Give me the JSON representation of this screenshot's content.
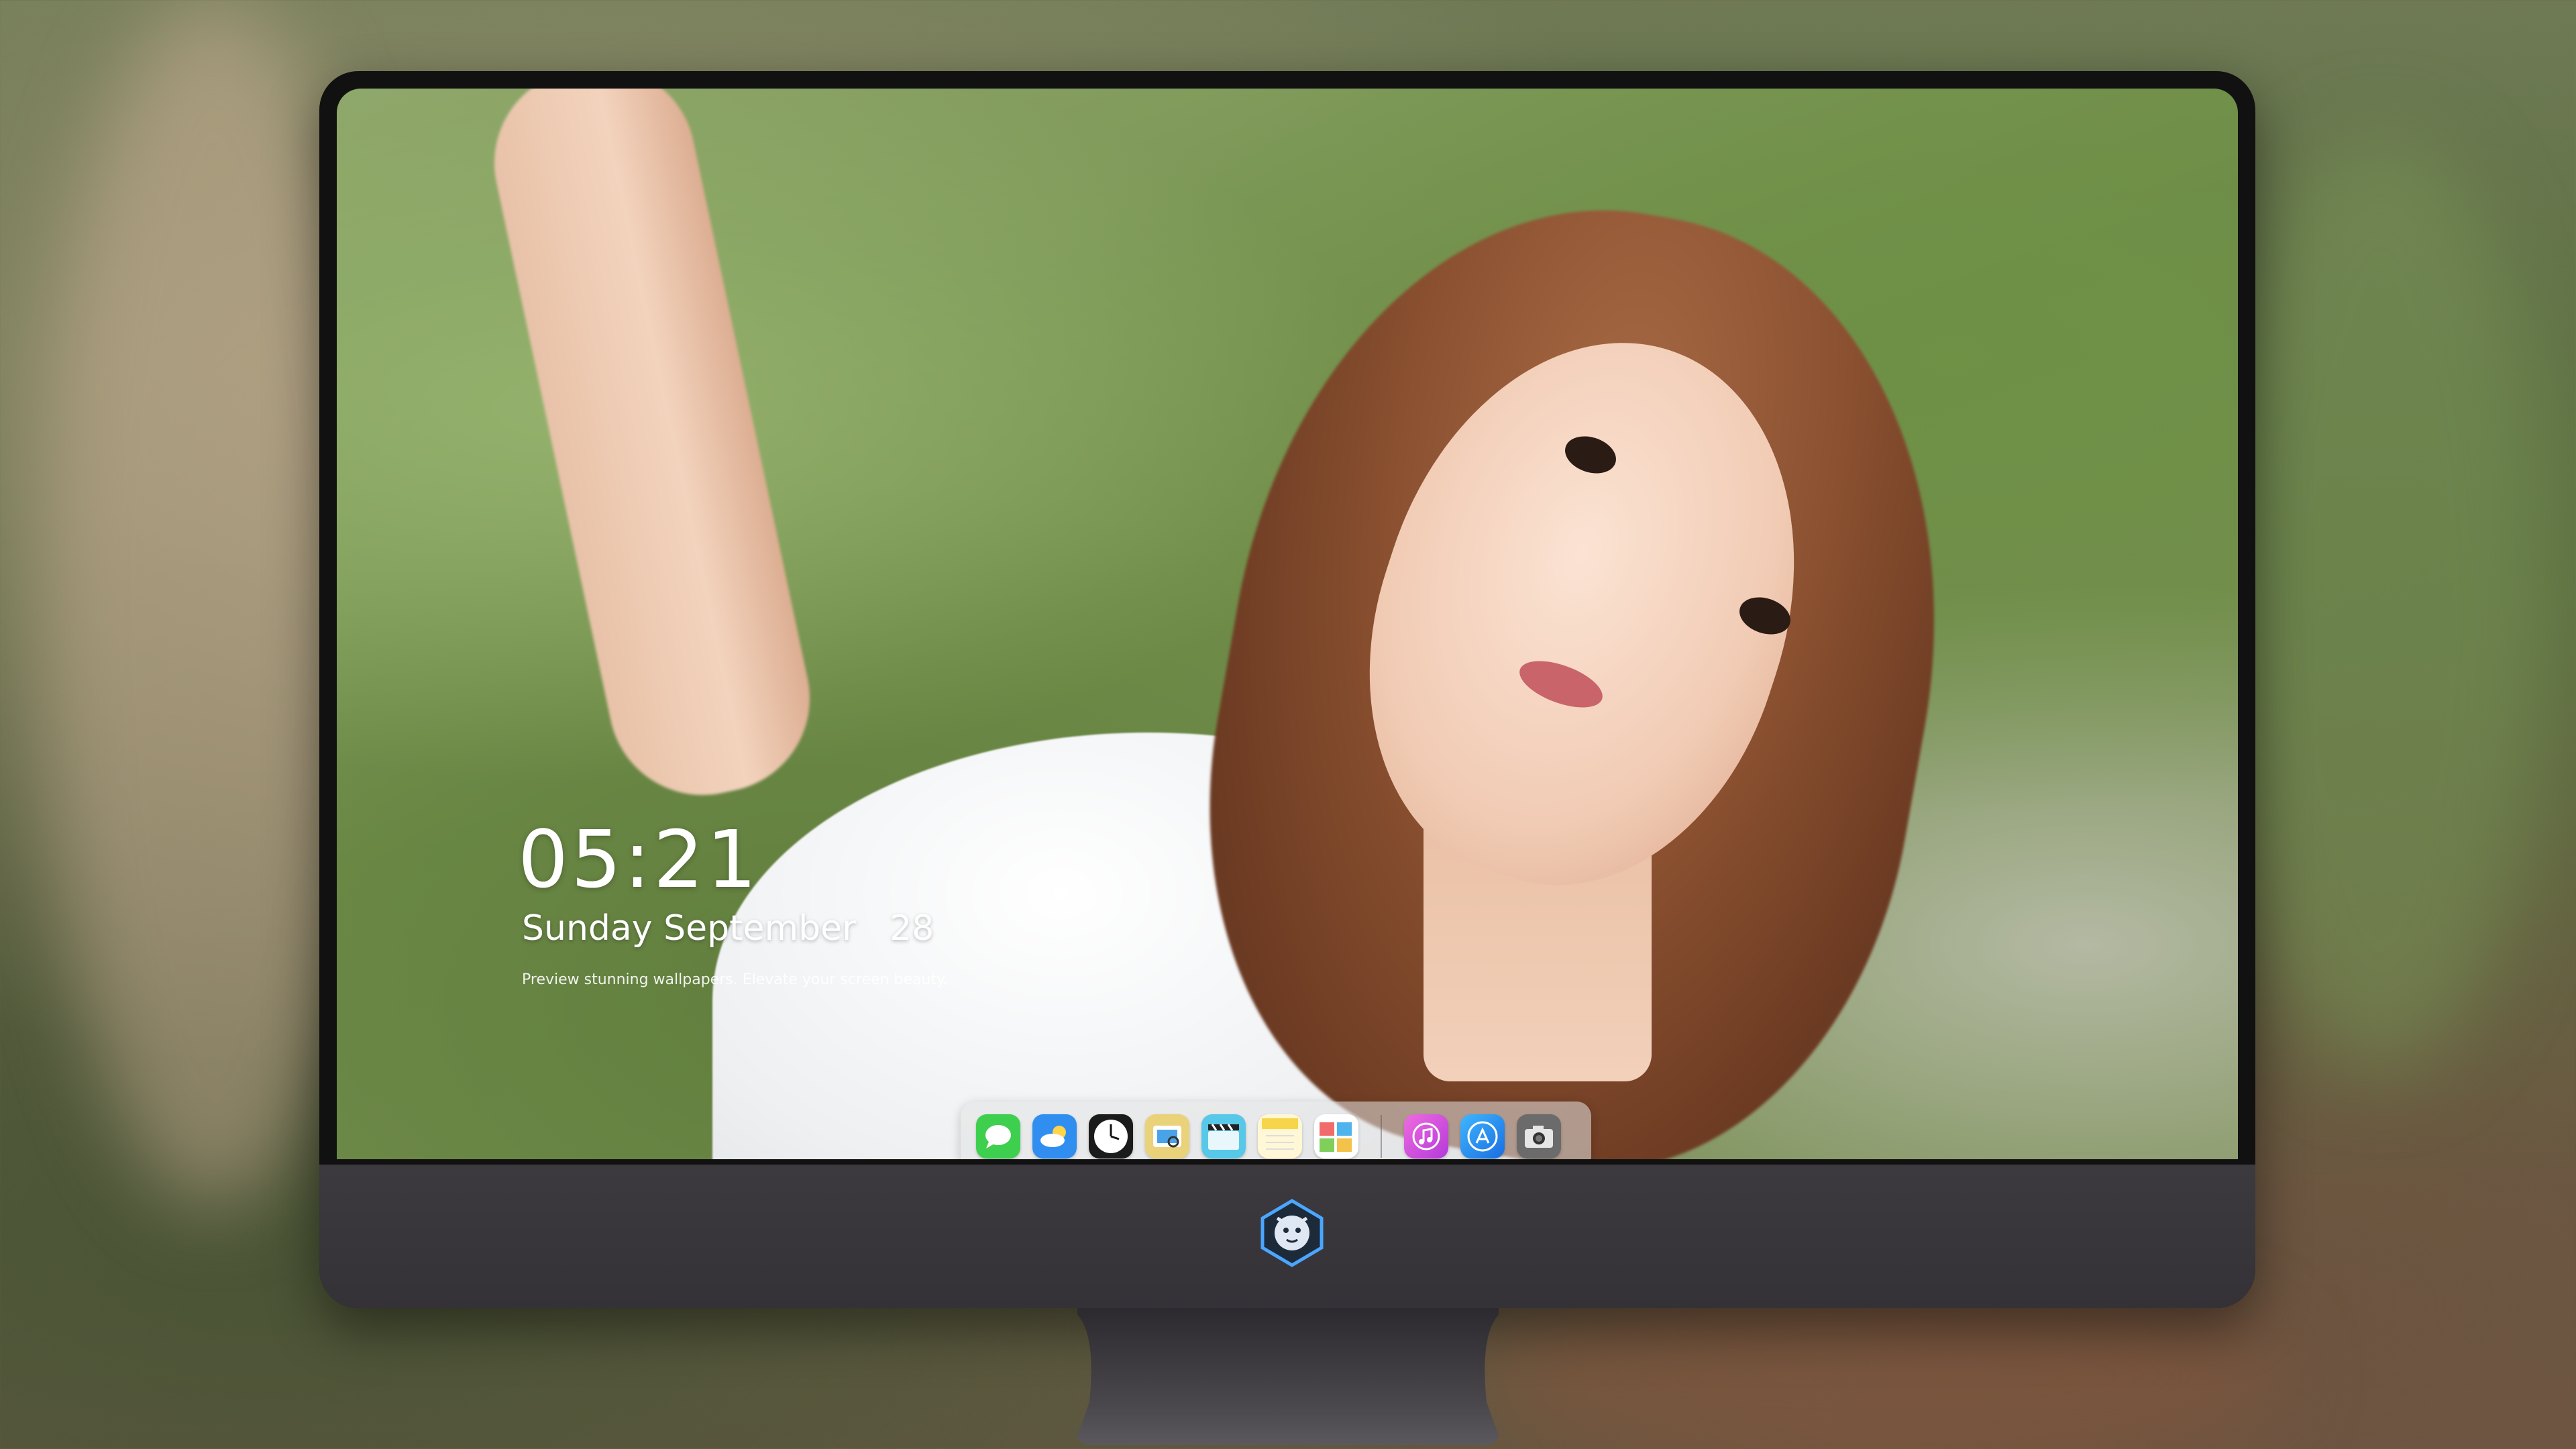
{
  "lock_screen": {
    "time": "05:21",
    "date": "Sunday September   28",
    "tagline": "Preview stunning wallpapers. Elevate your screen beauty."
  },
  "dock": {
    "apps": [
      {
        "name": "Messages",
        "icon": "messages-icon",
        "color": "#3ecf4f",
        "glyph": "💬"
      },
      {
        "name": "Weather",
        "icon": "weather-icon",
        "color": "#2f8ef0",
        "glyph": "⛅"
      },
      {
        "name": "Clock",
        "icon": "clock-icon",
        "color": "#1b1b1b",
        "glyph": "🕒"
      },
      {
        "name": "Preview",
        "icon": "preview-icon",
        "color": "#e9d27a",
        "glyph": "🖼"
      },
      {
        "name": "Videos",
        "icon": "clapperboard-icon",
        "color": "#58c8e8",
        "glyph": "🎬"
      },
      {
        "name": "Notes",
        "icon": "notes-icon",
        "color": "#f7d54a",
        "glyph": "▤"
      },
      {
        "name": "Photos",
        "icon": "photos-icon",
        "color": "#ffffff",
        "glyph": "▦"
      }
    ],
    "apps_right": [
      {
        "name": "Music",
        "icon": "music-icon",
        "color": "#d94bd8",
        "glyph": "♫"
      },
      {
        "name": "App Store",
        "icon": "app-store-icon",
        "color": "#2d8cf0",
        "glyph": "Ⓐ"
      },
      {
        "name": "Camera",
        "icon": "camera-icon",
        "color": "#6b6b6b",
        "glyph": "📷"
      }
    ]
  },
  "colors": {
    "bezel": "#111111",
    "chin": "#3d3a3f",
    "dock_bg": "rgba(225,225,225,0.55)"
  }
}
